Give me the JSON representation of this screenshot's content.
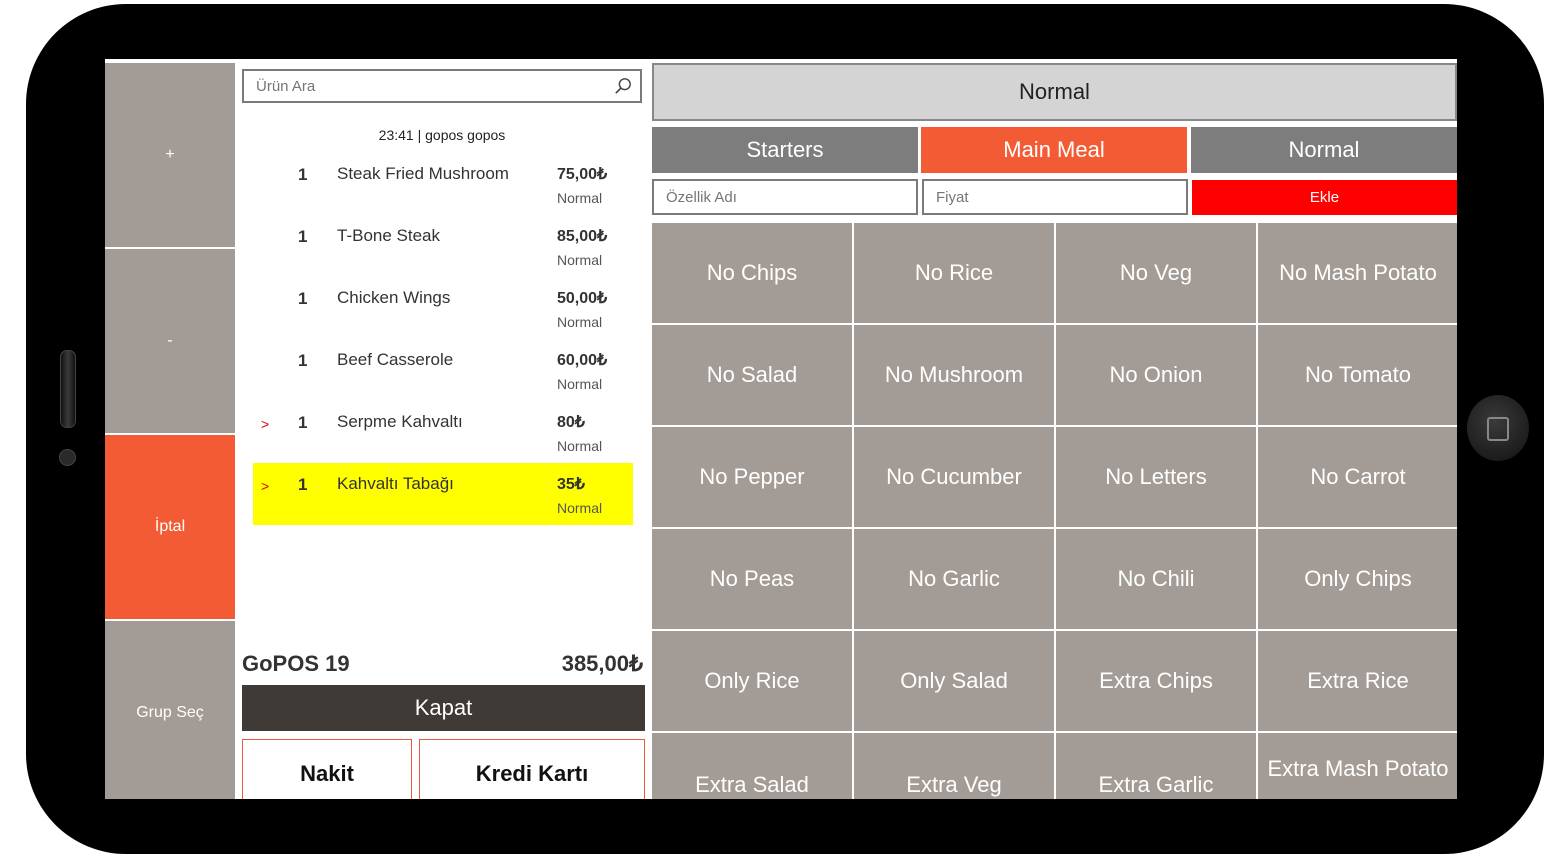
{
  "left_buttons": [
    "+",
    "-",
    "İptal",
    "Grup Seç"
  ],
  "search": {
    "placeholder": "Ürün Ara"
  },
  "order_header": "23:41 | gopos gopos",
  "order_items": [
    {
      "marker": "",
      "qty": "1",
      "name": "Steak Fried Mushroom",
      "price": "75,00₺",
      "note": "Normal"
    },
    {
      "marker": "",
      "qty": "1",
      "name": "T-Bone Steak",
      "price": "85,00₺",
      "note": "Normal"
    },
    {
      "marker": "",
      "qty": "1",
      "name": "Chicken Wings",
      "price": "50,00₺",
      "note": "Normal"
    },
    {
      "marker": "",
      "qty": "1",
      "name": "Beef Casserole",
      "price": "60,00₺",
      "note": "Normal"
    },
    {
      "marker": ">",
      "qty": "1",
      "name": "Serpme Kahvaltı",
      "price": "80₺",
      "note": "Normal"
    },
    {
      "marker": ">",
      "qty": "1",
      "name": "Kahvaltı Tabağı",
      "price": "35₺",
      "note": "Normal"
    }
  ],
  "table_label": "GoPOS 19",
  "total": "385,00₺",
  "kapat_label": "Kapat",
  "pay_buttons": [
    "Nakit",
    "Kredi Kartı"
  ],
  "top_option": "Normal",
  "tabs": [
    "Starters",
    "Main Meal",
    "Normal"
  ],
  "active_tab": "Main Meal",
  "feature_name_placeholder": "Özellik Adı",
  "price_placeholder": "Fiyat",
  "add_label": "Ekle",
  "options": [
    "No Chips",
    "No Rice",
    "No Veg",
    "No Mash Potato",
    "No Salad",
    "No Mushroom",
    "No Onion",
    "No Tomato",
    "No Pepper",
    "No Cucumber",
    "No Letters",
    "No Carrot",
    "No Peas",
    "No Garlic",
    "No Chili",
    "Only Chips",
    "Only Rice",
    "Only Salad",
    "Extra Chips",
    "Extra Rice",
    "Extra Salad",
    "Extra Veg",
    "Extra Garlic",
    "Extra Mash Potato"
  ],
  "colors": {
    "accent": "#f35b35",
    "tile": "#a39b95",
    "highlight": "#ffff00",
    "add_button": "#ff0000",
    "tab": "#7d7d7d",
    "close_button": "#403a36"
  }
}
